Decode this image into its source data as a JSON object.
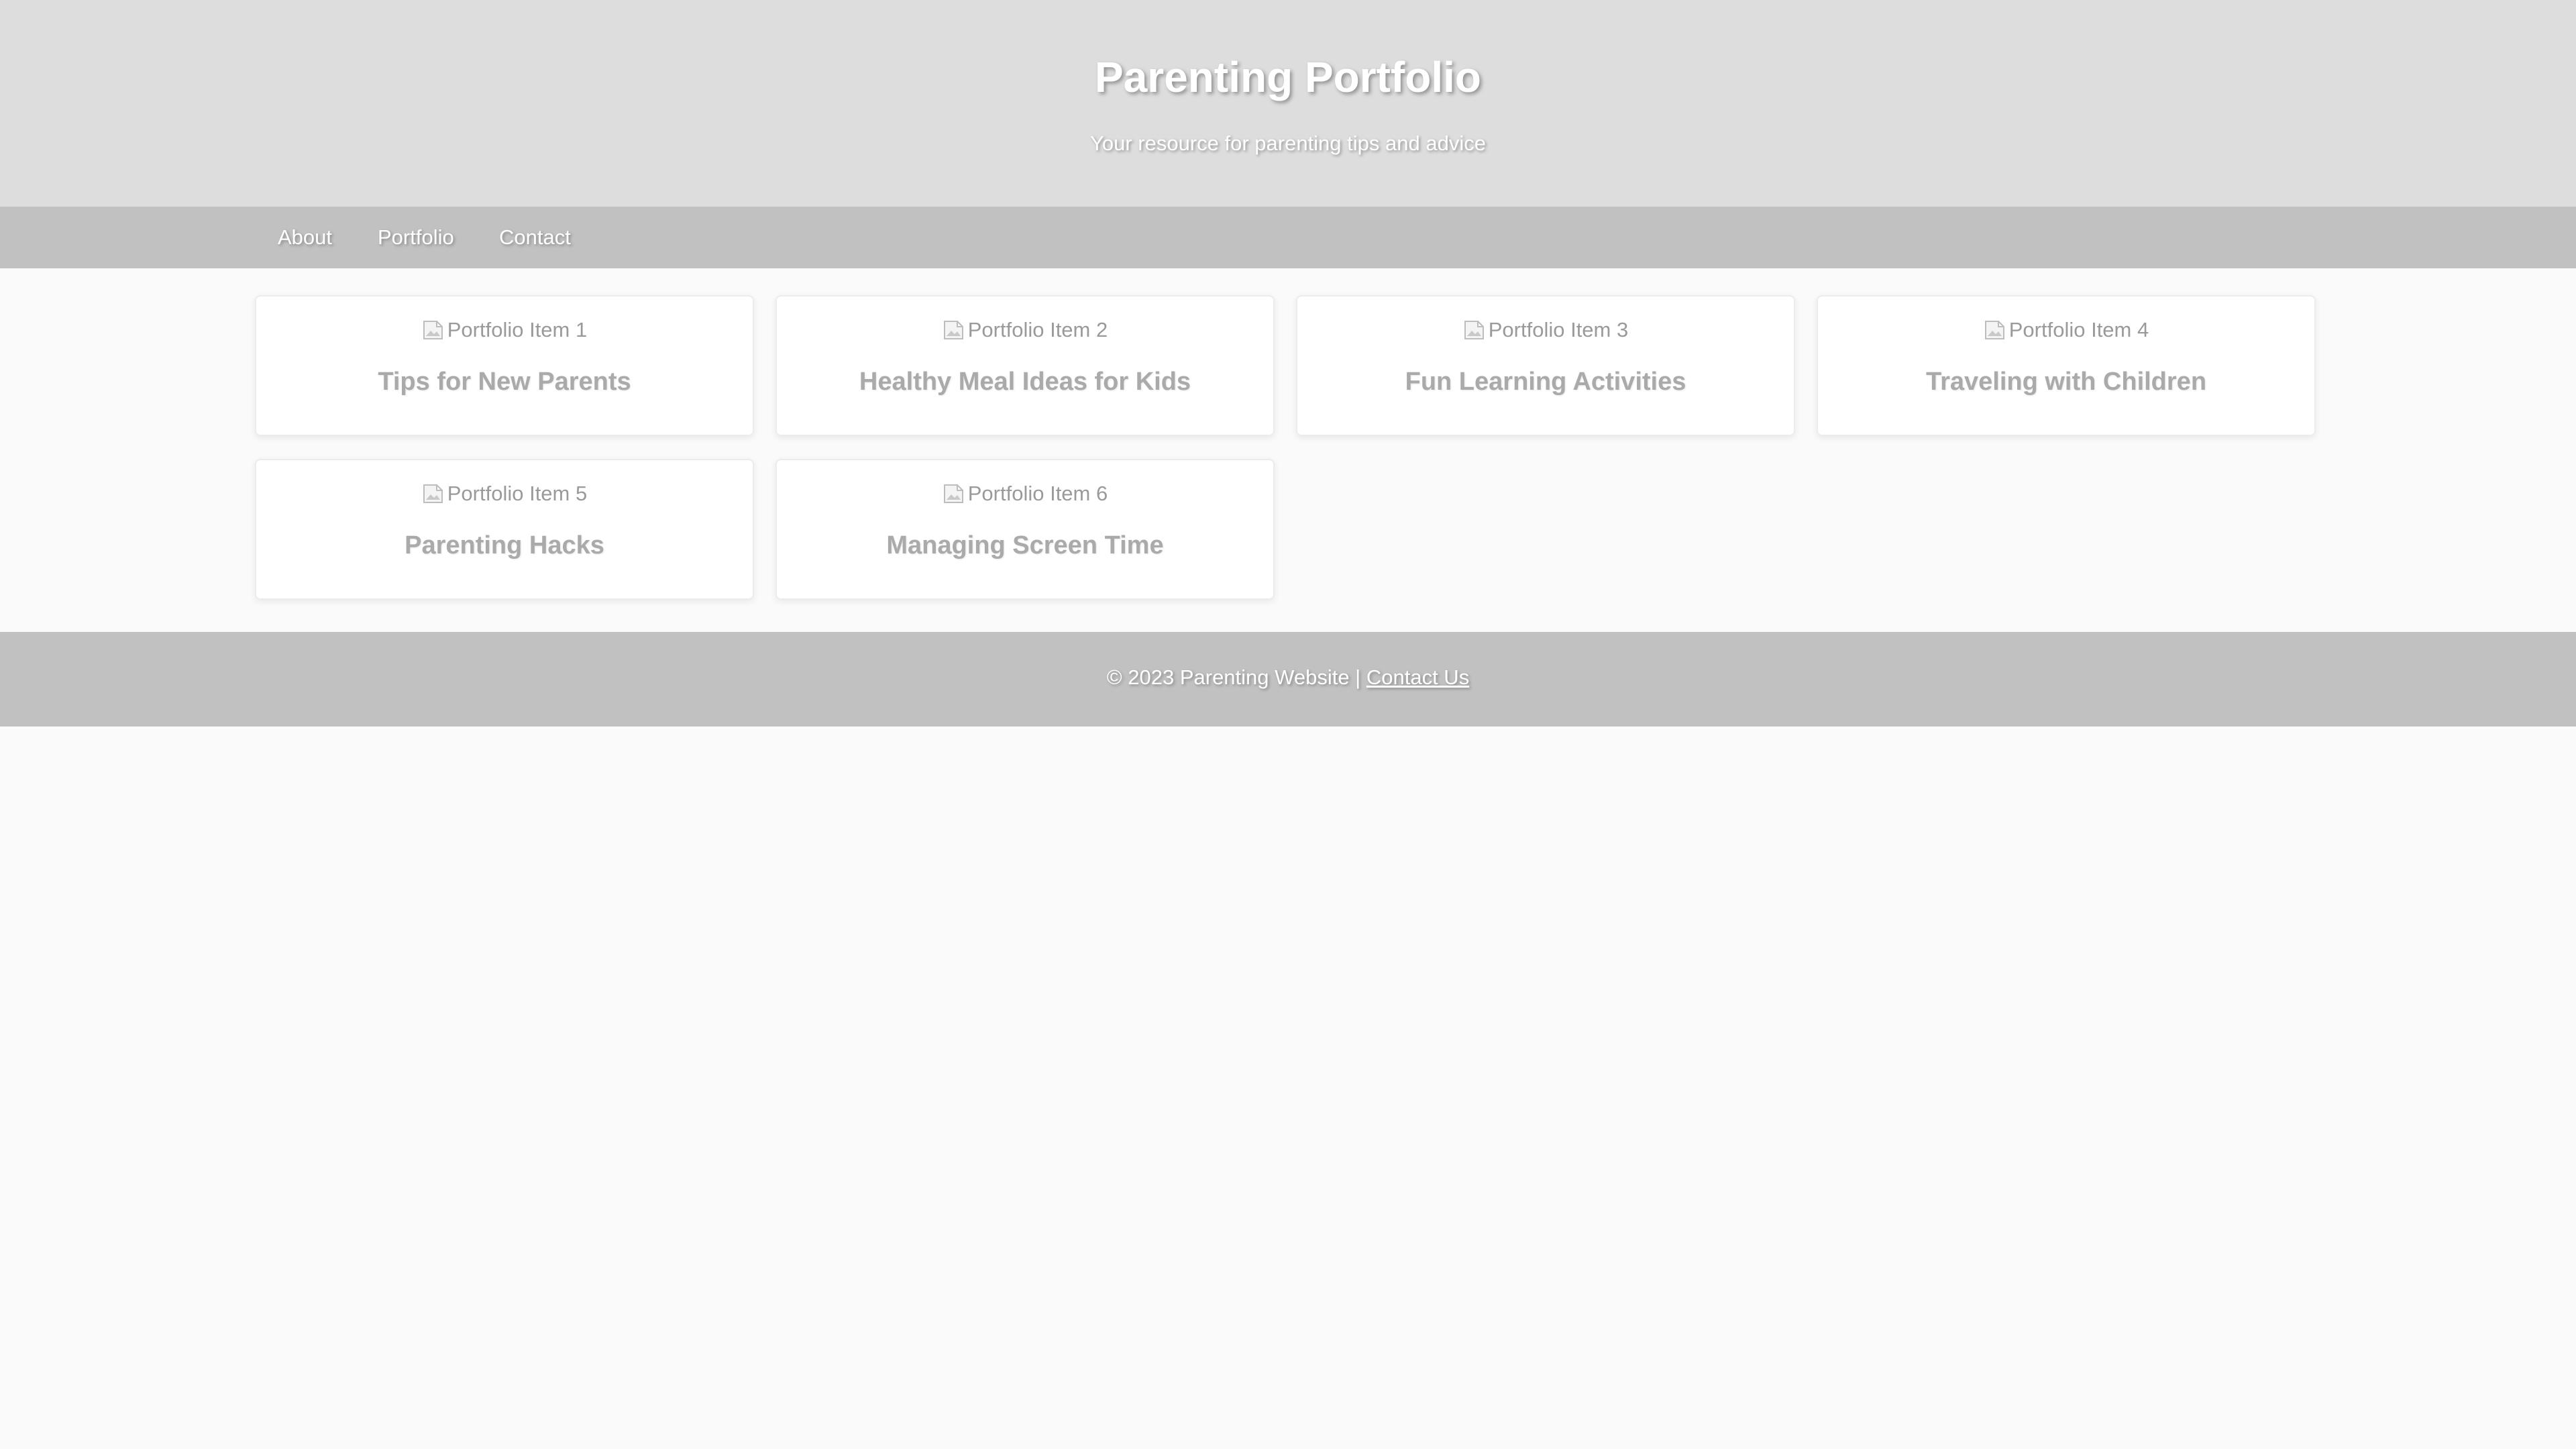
{
  "header": {
    "title": "Parenting Portfolio",
    "subtitle": "Your resource for parenting tips and advice"
  },
  "nav": {
    "items": [
      {
        "label": "About"
      },
      {
        "label": "Portfolio"
      },
      {
        "label": "Contact"
      }
    ]
  },
  "portfolio": {
    "items": [
      {
        "image_alt": "Portfolio Item 1",
        "title": "Tips for New Parents"
      },
      {
        "image_alt": "Portfolio Item 2",
        "title": "Healthy Meal Ideas for Kids"
      },
      {
        "image_alt": "Portfolio Item 3",
        "title": "Fun Learning Activities"
      },
      {
        "image_alt": "Portfolio Item 4",
        "title": "Traveling with Children"
      },
      {
        "image_alt": "Portfolio Item 5",
        "title": "Parenting Hacks"
      },
      {
        "image_alt": "Portfolio Item 6",
        "title": "Managing Screen Time"
      }
    ]
  },
  "footer": {
    "copyright": "© 2023 Parenting Website |",
    "link_label": "Contact Us"
  },
  "colors": {
    "header_bg": "#dddddd",
    "nav_bg": "#c1c1c1",
    "page_bg": "#fafafa",
    "card_title": "#aaaaaa"
  },
  "icons": {
    "card_image": "broken-image-icon"
  }
}
